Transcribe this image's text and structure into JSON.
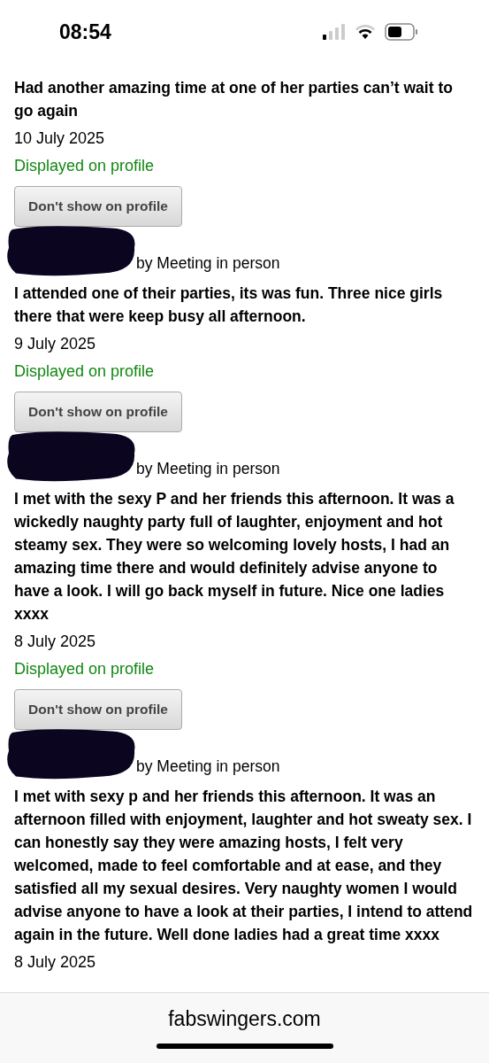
{
  "status_bar": {
    "time": "08:54"
  },
  "reviews": [
    {
      "text": "Had another amazing time at one of her parties can’t wait to go again",
      "date": "10 July 2025",
      "status": "Displayed on profile",
      "button": "Don't show on profile"
    },
    {
      "author": "by Meeting in person",
      "text": "I attended one of their parties, its was fun. Three nice girls there that were keep busy all afternoon.",
      "date": "9 July 2025",
      "status": "Displayed on profile",
      "button": "Don't show on profile"
    },
    {
      "author": "by Meeting in person",
      "text": "I met with the sexy P and her friends this afternoon. It was a wickedly naughty party full of laughter, enjoyment and hot steamy sex. They were so welcoming lovely hosts, I had an amazing time there and would definitely advise anyone to have a look. I will go back myself in future. Nice one ladies xxxx",
      "date": "8 July 2025",
      "status": "Displayed on profile",
      "button": "Don't show on profile"
    },
    {
      "author": "by Meeting in person",
      "text": "I met with sexy p and her friends this afternoon. It was an afternoon filled with enjoyment, laughter and hot sweaty sex. I can honestly say they were amazing hosts, I felt very welcomed, made to feel comfortable and at ease, and they satisfied all my sexual desires. Very naughty women I would advise anyone to have a look at their parties, I intend to attend again in the future. Well done ladies had a great time xxxx",
      "date": "8 July 2025"
    }
  ],
  "address_bar": {
    "url": "fabswingers.com"
  }
}
